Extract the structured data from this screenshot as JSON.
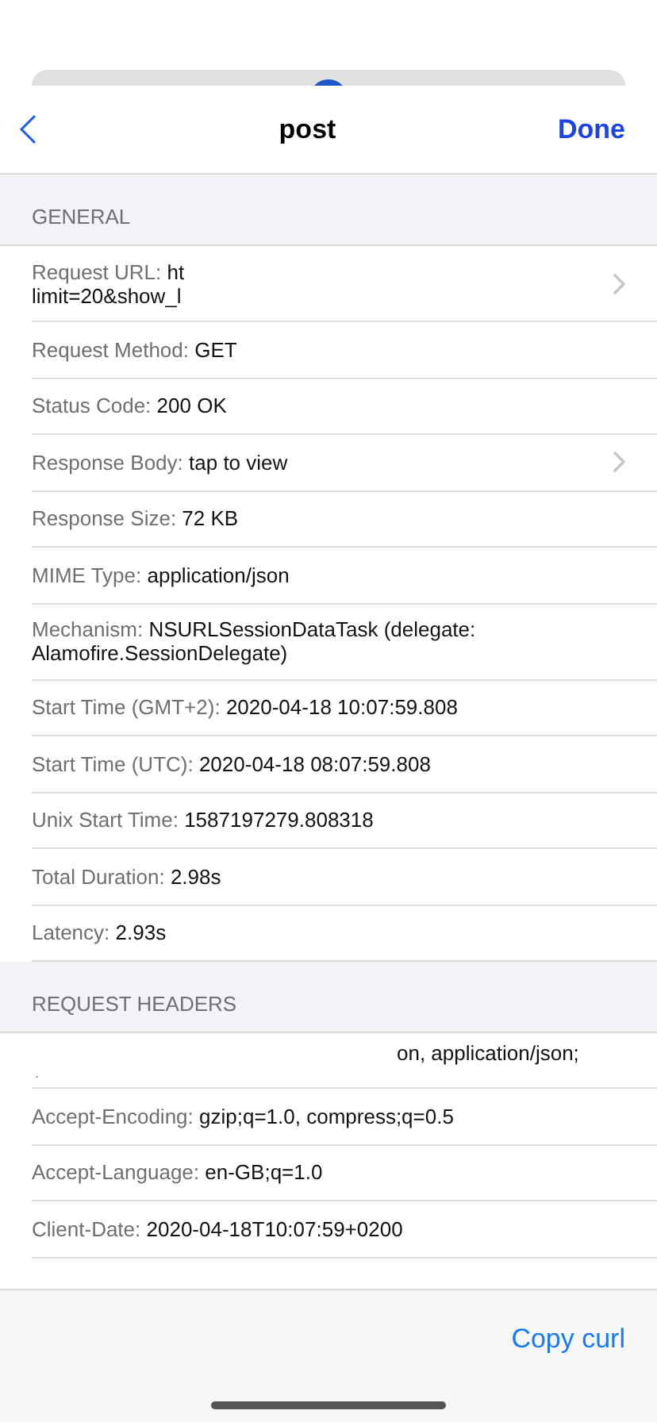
{
  "nav": {
    "title": "post",
    "done": "Done"
  },
  "sections": [
    {
      "title": "GENERAL",
      "rows": [
        {
          "kind": "field",
          "label": "Request URL: ",
          "value": "ht\nlimit=20&show_l",
          "disclosure": true
        },
        {
          "kind": "field",
          "label": "Request Method: ",
          "value": "GET",
          "disclosure": false
        },
        {
          "kind": "field",
          "label": "Status Code: ",
          "value": "200 OK",
          "disclosure": false
        },
        {
          "kind": "field",
          "label": "Response Body: ",
          "value": "tap to view",
          "disclosure": true
        },
        {
          "kind": "field",
          "label": "Response Size: ",
          "value": "72 KB",
          "disclosure": false
        },
        {
          "kind": "field",
          "label": "MIME Type: ",
          "value": "application/json",
          "disclosure": false
        },
        {
          "kind": "field",
          "label": "Mechanism: ",
          "value": "NSURLSessionDataTask (delegate:\nAlamofire.SessionDelegate)",
          "disclosure": false
        },
        {
          "kind": "field",
          "label": "Start Time (GMT+2): ",
          "value": "2020-04-18 10:07:59.808",
          "disclosure": false
        },
        {
          "kind": "field",
          "label": "Start Time (UTC): ",
          "value": "2020-04-18 08:07:59.808",
          "disclosure": false
        },
        {
          "kind": "field",
          "label": "Unix Start Time: ",
          "value": "1587197279.808318",
          "disclosure": false
        },
        {
          "kind": "field",
          "label": "Total Duration: ",
          "value": "2.98s",
          "disclosure": false
        },
        {
          "kind": "field",
          "label": "Latency: ",
          "value": "2.93s",
          "disclosure": false
        }
      ]
    },
    {
      "title": "REQUEST HEADERS",
      "rows": [
        {
          "kind": "clipped",
          "value": "on, application/json;",
          "tail": "."
        },
        {
          "kind": "field",
          "label": "Accept-Encoding: ",
          "value": "gzip;q=1.0, compress;q=0.5",
          "disclosure": false
        },
        {
          "kind": "field",
          "label": "Accept-Language: ",
          "value": "en-GB;q=1.0",
          "disclosure": false
        },
        {
          "kind": "field",
          "label": "Client-Date: ",
          "value": "2020-04-18T10:07:59+0200",
          "disclosure": false
        }
      ]
    }
  ],
  "toolbar": {
    "action": "Copy curl"
  }
}
